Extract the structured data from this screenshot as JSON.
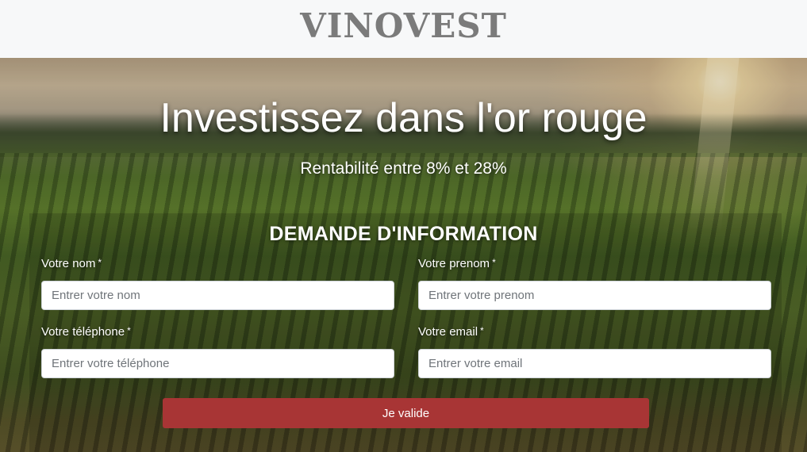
{
  "header": {
    "logo": "VINOVEST"
  },
  "hero": {
    "headline": "Investissez dans l'or rouge",
    "subline": "Rentabilité entre 8% et 28%"
  },
  "form": {
    "title": "DEMANDE D'INFORMATION",
    "fields": {
      "nom": {
        "label": "Votre nom",
        "required_mark": "*",
        "placeholder": "Entrer votre nom",
        "value": ""
      },
      "prenom": {
        "label": "Votre prenom",
        "required_mark": "*",
        "placeholder": "Entrer votre prenom",
        "value": ""
      },
      "telephone": {
        "label": "Votre téléphone",
        "required_mark": "*",
        "placeholder": "Entrer votre téléphone",
        "value": ""
      },
      "email": {
        "label": "Votre email",
        "required_mark": "*",
        "placeholder": "Entrer votre email",
        "value": ""
      }
    },
    "submit_label": "Je valide"
  },
  "colors": {
    "header_bg": "#f7f8f9",
    "logo": "#7b7b7b",
    "submit_bg": "#a83535",
    "text_on_image": "#ffffff"
  }
}
